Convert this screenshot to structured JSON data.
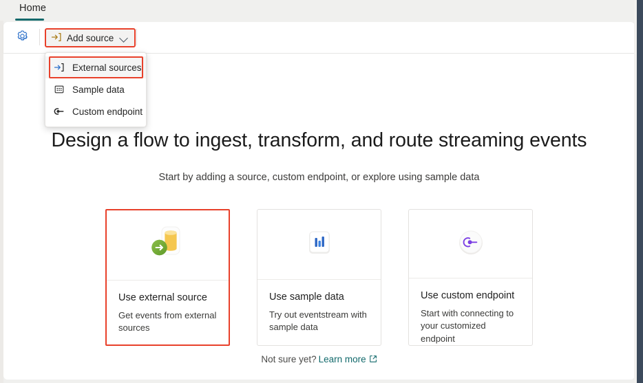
{
  "window": {
    "tab": {
      "label": "Home"
    },
    "accent_teal": "#11696b",
    "highlight_red": "#e8402a",
    "right_rail_color": "#3c4a5c"
  },
  "toolbar": {
    "settings_icon": "gear-icon",
    "add_source": {
      "label": "Add source",
      "icon": "arrow-into-bracket-icon",
      "chevron": "chevron-down-icon",
      "highlighted": true
    }
  },
  "menu": {
    "open": true,
    "items": [
      {
        "label": "External sources",
        "icon": "arrow-into-bracket-icon",
        "highlighted": true
      },
      {
        "label": "Sample data",
        "icon": "dotted-square-icon",
        "highlighted": false
      },
      {
        "label": "Custom endpoint",
        "icon": "endpoint-plug-icon",
        "highlighted": false
      }
    ]
  },
  "main": {
    "headline": "Design a flow to ingest, transform, and route streaming events",
    "subheadline": "Start by adding a source, custom endpoint, or explore using sample data",
    "cards": [
      {
        "title": "Use external source",
        "description": "Get events from external sources",
        "icon": "database-import-icon",
        "selected": true
      },
      {
        "title": "Use sample data",
        "description": "Try out eventstream with sample data",
        "icon": "bar-chart-tile-icon",
        "selected": false
      },
      {
        "title": "Use custom endpoint",
        "description": "Start with connecting to your customized endpoint",
        "icon": "custom-endpoint-icon",
        "selected": false
      }
    ],
    "footnote": {
      "prompt": "Not sure yet?",
      "link_label": "Learn more",
      "link_icon": "external-link-icon"
    }
  }
}
